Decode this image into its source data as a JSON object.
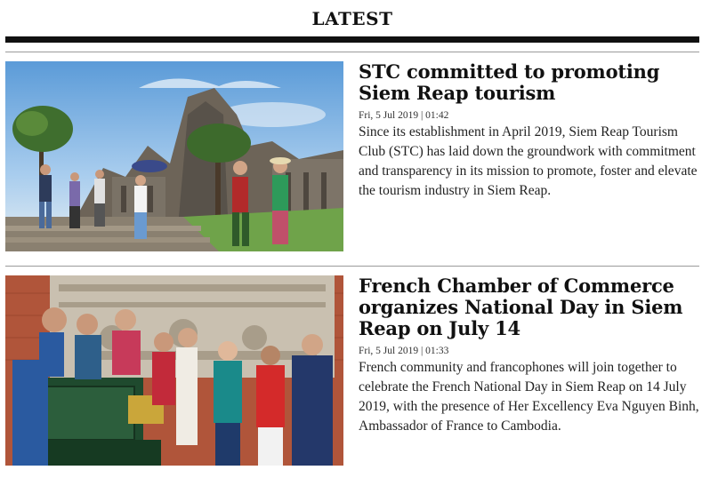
{
  "section": {
    "title": "LATEST"
  },
  "articles": [
    {
      "headline": "STC committed to promoting Siem Reap tourism",
      "date": "Fri, 5 Jul 2019 | 01:42",
      "summary": "Since its establishment in April 2019, Siem Reap Tourism Club (STC) has laid down the groundwork with commitment and transparency in its mission to promote, foster and elevate the tourism industry in Siem Reap.",
      "image": "angkor-wat-tourists-photo"
    },
    {
      "headline": "French Chamber of Commerce organizes National Day in Siem Reap on July 14",
      "date": "Fri, 5 Jul 2019 | 01:33",
      "summary": "French community and francophones will join together to celebrate the French National Day in Siem Reap on 14 July 2019, with the presence of Her Excellency Eva Nguyen Binh, Ambassador of France to Cambodia.",
      "image": "french-delegation-photo"
    }
  ]
}
